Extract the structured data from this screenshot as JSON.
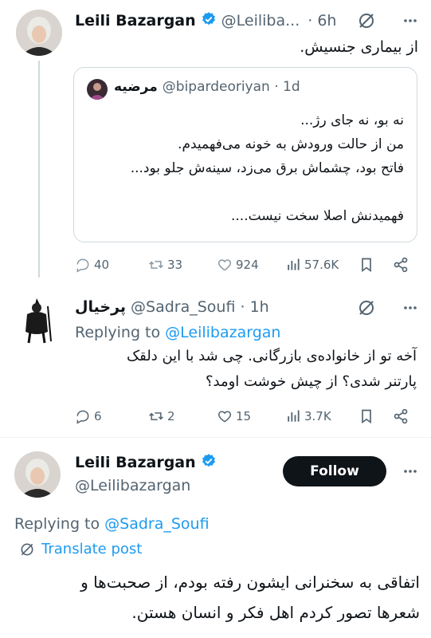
{
  "tweet1": {
    "name": "Leili Bazargan",
    "handle": "@Leiliba...",
    "dot": "·",
    "time": "6h",
    "text": "از بیماری جنسیش.",
    "quote": {
      "name": "مرضیه",
      "handle": "@bipardeoriyan · 1d",
      "lines": [
        "نه بو، نه جای رژ...",
        "من از حالت ورودش به خونه می‌فهمیدم.",
        "فاتح بود، چشماش برق می‌زد، سینه‌ش جلو بود...",
        "فهمیدنش اصلا سخت نیست...."
      ]
    },
    "actions": {
      "replies": "40",
      "retweets": "33",
      "likes": "924",
      "views": "57.6K"
    }
  },
  "tweet2": {
    "name": "پرخیال",
    "handle": "@Sadra_Soufi · 1h",
    "replying_prefix": "Replying to ",
    "replying_to": "@Leilibazargan",
    "lines": [
      "آخه تو از خانواده‌ی بازرگانی. چی شد با این دلقک",
      "پارتنر شدی؟ از چیش خوشت اومد؟"
    ],
    "actions": {
      "replies": "6",
      "retweets": "2",
      "likes": "15",
      "views": "3.7K"
    }
  },
  "tweet3": {
    "name": "Leili Bazargan",
    "handle": "@Leilibazargan",
    "follow_label": "Follow",
    "replying_prefix": "Replying to ",
    "replying_to": "@Sadra_Soufi",
    "translate_label": "Translate post",
    "lines": [
      "اتفاقی به سخنرانی ایشون رفته بودم، از صحبت‌ها و",
      "شعرها تصور کردم اهل فکر و انسان هستن."
    ]
  },
  "colors": {
    "verified": "#1d9bf0",
    "link": "#1d9bf0",
    "muted": "#536471",
    "border": "#cfd9de"
  }
}
